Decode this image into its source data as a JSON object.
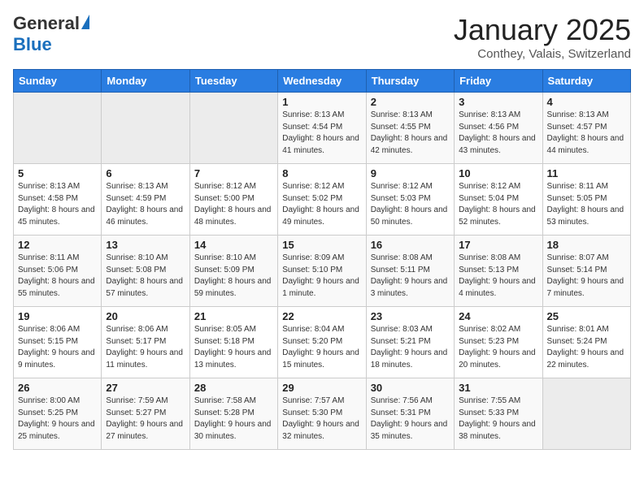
{
  "header": {
    "logo_general": "General",
    "logo_blue": "Blue",
    "month_title": "January 2025",
    "location": "Conthey, Valais, Switzerland"
  },
  "days_of_week": [
    "Sunday",
    "Monday",
    "Tuesday",
    "Wednesday",
    "Thursday",
    "Friday",
    "Saturday"
  ],
  "weeks": [
    [
      {
        "day": "",
        "info": ""
      },
      {
        "day": "",
        "info": ""
      },
      {
        "day": "",
        "info": ""
      },
      {
        "day": "1",
        "info": "Sunrise: 8:13 AM\nSunset: 4:54 PM\nDaylight: 8 hours and 41 minutes."
      },
      {
        "day": "2",
        "info": "Sunrise: 8:13 AM\nSunset: 4:55 PM\nDaylight: 8 hours and 42 minutes."
      },
      {
        "day": "3",
        "info": "Sunrise: 8:13 AM\nSunset: 4:56 PM\nDaylight: 8 hours and 43 minutes."
      },
      {
        "day": "4",
        "info": "Sunrise: 8:13 AM\nSunset: 4:57 PM\nDaylight: 8 hours and 44 minutes."
      }
    ],
    [
      {
        "day": "5",
        "info": "Sunrise: 8:13 AM\nSunset: 4:58 PM\nDaylight: 8 hours and 45 minutes."
      },
      {
        "day": "6",
        "info": "Sunrise: 8:13 AM\nSunset: 4:59 PM\nDaylight: 8 hours and 46 minutes."
      },
      {
        "day": "7",
        "info": "Sunrise: 8:12 AM\nSunset: 5:00 PM\nDaylight: 8 hours and 48 minutes."
      },
      {
        "day": "8",
        "info": "Sunrise: 8:12 AM\nSunset: 5:02 PM\nDaylight: 8 hours and 49 minutes."
      },
      {
        "day": "9",
        "info": "Sunrise: 8:12 AM\nSunset: 5:03 PM\nDaylight: 8 hours and 50 minutes."
      },
      {
        "day": "10",
        "info": "Sunrise: 8:12 AM\nSunset: 5:04 PM\nDaylight: 8 hours and 52 minutes."
      },
      {
        "day": "11",
        "info": "Sunrise: 8:11 AM\nSunset: 5:05 PM\nDaylight: 8 hours and 53 minutes."
      }
    ],
    [
      {
        "day": "12",
        "info": "Sunrise: 8:11 AM\nSunset: 5:06 PM\nDaylight: 8 hours and 55 minutes."
      },
      {
        "day": "13",
        "info": "Sunrise: 8:10 AM\nSunset: 5:08 PM\nDaylight: 8 hours and 57 minutes."
      },
      {
        "day": "14",
        "info": "Sunrise: 8:10 AM\nSunset: 5:09 PM\nDaylight: 8 hours and 59 minutes."
      },
      {
        "day": "15",
        "info": "Sunrise: 8:09 AM\nSunset: 5:10 PM\nDaylight: 9 hours and 1 minute."
      },
      {
        "day": "16",
        "info": "Sunrise: 8:08 AM\nSunset: 5:11 PM\nDaylight: 9 hours and 3 minutes."
      },
      {
        "day": "17",
        "info": "Sunrise: 8:08 AM\nSunset: 5:13 PM\nDaylight: 9 hours and 4 minutes."
      },
      {
        "day": "18",
        "info": "Sunrise: 8:07 AM\nSunset: 5:14 PM\nDaylight: 9 hours and 7 minutes."
      }
    ],
    [
      {
        "day": "19",
        "info": "Sunrise: 8:06 AM\nSunset: 5:15 PM\nDaylight: 9 hours and 9 minutes."
      },
      {
        "day": "20",
        "info": "Sunrise: 8:06 AM\nSunset: 5:17 PM\nDaylight: 9 hours and 11 minutes."
      },
      {
        "day": "21",
        "info": "Sunrise: 8:05 AM\nSunset: 5:18 PM\nDaylight: 9 hours and 13 minutes."
      },
      {
        "day": "22",
        "info": "Sunrise: 8:04 AM\nSunset: 5:20 PM\nDaylight: 9 hours and 15 minutes."
      },
      {
        "day": "23",
        "info": "Sunrise: 8:03 AM\nSunset: 5:21 PM\nDaylight: 9 hours and 18 minutes."
      },
      {
        "day": "24",
        "info": "Sunrise: 8:02 AM\nSunset: 5:23 PM\nDaylight: 9 hours and 20 minutes."
      },
      {
        "day": "25",
        "info": "Sunrise: 8:01 AM\nSunset: 5:24 PM\nDaylight: 9 hours and 22 minutes."
      }
    ],
    [
      {
        "day": "26",
        "info": "Sunrise: 8:00 AM\nSunset: 5:25 PM\nDaylight: 9 hours and 25 minutes."
      },
      {
        "day": "27",
        "info": "Sunrise: 7:59 AM\nSunset: 5:27 PM\nDaylight: 9 hours and 27 minutes."
      },
      {
        "day": "28",
        "info": "Sunrise: 7:58 AM\nSunset: 5:28 PM\nDaylight: 9 hours and 30 minutes."
      },
      {
        "day": "29",
        "info": "Sunrise: 7:57 AM\nSunset: 5:30 PM\nDaylight: 9 hours and 32 minutes."
      },
      {
        "day": "30",
        "info": "Sunrise: 7:56 AM\nSunset: 5:31 PM\nDaylight: 9 hours and 35 minutes."
      },
      {
        "day": "31",
        "info": "Sunrise: 7:55 AM\nSunset: 5:33 PM\nDaylight: 9 hours and 38 minutes."
      },
      {
        "day": "",
        "info": ""
      }
    ]
  ]
}
